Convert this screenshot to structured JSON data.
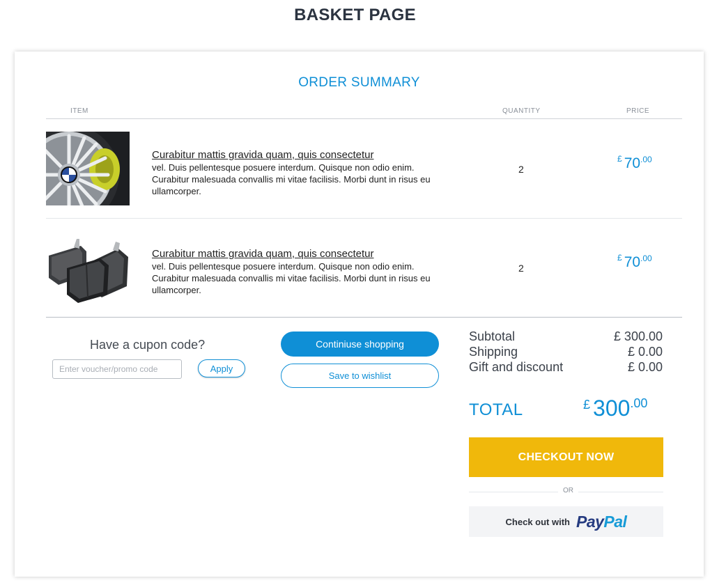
{
  "page": {
    "title": "BASKET PAGE"
  },
  "summary": {
    "title": "ORDER SUMMARY",
    "columns": {
      "item": "ITEM",
      "quantity": "QUANTITY",
      "price": "PRICE"
    }
  },
  "items": [
    {
      "title": "Curabitur mattis gravida quam, quis consectetur",
      "description": "vel. Duis pellentesque posuere interdum. Quisque non odio enim. Curabitur malesuada convallis mi vitae facilisis. Morbi dunt in risus eu ullamcorper.",
      "quantity": "2",
      "currency": "£",
      "price_main": "70",
      "price_decimal": ".00",
      "image_icon": "alloy-wheel-icon"
    },
    {
      "title": "Curabitur mattis gravida quam, quis consectetur",
      "description": "vel. Duis pellentesque posuere interdum. Quisque non odio enim. Curabitur malesuada convallis mi vitae facilisis. Morbi dunt in risus eu ullamcorper.",
      "quantity": "2",
      "currency": "£",
      "price_main": "70",
      "price_decimal": ".00",
      "image_icon": "brake-pads-icon"
    }
  ],
  "coupon": {
    "label": "Have a cupon code?",
    "placeholder": "Enter voucher/promo code",
    "apply_label": "Apply"
  },
  "actions": {
    "continue_label": "Continiuse shopping",
    "wishlist_label": "Save to wishlist"
  },
  "totals": {
    "subtotal_label": "Subtotal",
    "subtotal_value": "£ 300.00",
    "shipping_label": "Shipping",
    "shipping_value": "£ 0.00",
    "discount_label": "Gift and discount",
    "discount_value": "£ 0.00",
    "total_label": "TOTAL",
    "total_currency": "£",
    "total_main": "300",
    "total_decimal": ".00"
  },
  "checkout": {
    "button_label": "CHECKOUT NOW",
    "or_label": "OR",
    "paypal_text": "Check out with",
    "paypal_logo_pay": "Pay",
    "paypal_logo_pal": "Pal"
  },
  "colors": {
    "accent": "#0f8fd6",
    "checkout": "#f0b80b",
    "paypal_dark": "#253b80",
    "paypal_light": "#179bd7"
  }
}
